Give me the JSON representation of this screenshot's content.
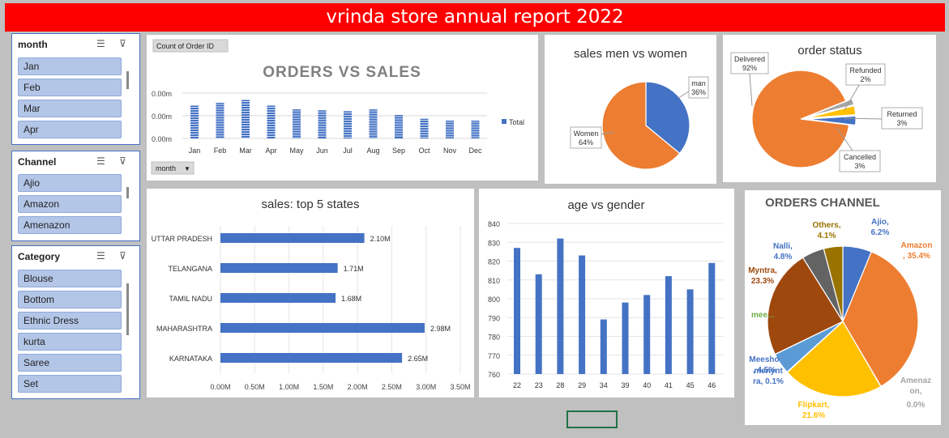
{
  "title": "vrinda store annual report 2022",
  "slicers": {
    "month": {
      "label": "month",
      "items": [
        "Jan",
        "Feb",
        "Mar",
        "Apr"
      ]
    },
    "channel": {
      "label": "Channel",
      "items": [
        "Ajio",
        "Amazon",
        "Amenazon"
      ]
    },
    "category": {
      "label": "Category",
      "items": [
        "Blouse",
        "Bottom",
        "Ethnic Dress",
        "kurta",
        "Saree",
        "Set"
      ]
    }
  },
  "colors": {
    "blue": "#4472c4",
    "orange": "#ed7d31",
    "gray": "#a5a5a5",
    "yellow": "#ffc000",
    "banner": "#ff0000",
    "green": "#70ad47",
    "brown": "#9e480e",
    "darkgray": "#636363",
    "olive": "#997300"
  },
  "chart_data": [
    {
      "id": "orders_vs_sales",
      "type": "bar",
      "title": "ORDERS VS SALES",
      "field_button": "Count of Order ID",
      "axis_button": "month",
      "categories": [
        "Jan",
        "Feb",
        "Mar",
        "Apr",
        "May",
        "Jun",
        "Jul",
        "Aug",
        "Sep",
        "Oct",
        "Nov",
        "Dec"
      ],
      "series": [
        {
          "name": "Total",
          "values": [
            0.0035,
            0.0038,
            0.0041,
            0.0035,
            0.0031,
            0.003,
            0.0029,
            0.0031,
            0.0025,
            0.0021,
            0.0019,
            0.0019
          ]
        }
      ],
      "ytick_labels": [
        "0.00m",
        "0.00m",
        "0.00m"
      ],
      "legend": "right"
    },
    {
      "id": "sales_men_vs_women",
      "type": "pie",
      "title": "sales men vs women",
      "slices": [
        {
          "label": "man",
          "pct_label": "36%",
          "value": 36,
          "color": "#4472c4"
        },
        {
          "label": "Women",
          "pct_label": "64%",
          "value": 64,
          "color": "#ed7d31"
        }
      ]
    },
    {
      "id": "order_status",
      "type": "pie",
      "title": "order status",
      "slices": [
        {
          "label": "Delivered",
          "pct_label": "92%",
          "value": 92,
          "color": "#ed7d31"
        },
        {
          "label": "Refunded",
          "pct_label": "2%",
          "value": 2,
          "color": "#a5a5a5"
        },
        {
          "label": "Returned",
          "pct_label": "3%",
          "value": 3,
          "color": "#ffc000"
        },
        {
          "label": "Cancelled",
          "pct_label": "3%",
          "value": 3,
          "color": "#4472c4"
        }
      ]
    },
    {
      "id": "top5_states",
      "type": "bar",
      "orientation": "horizontal",
      "title": "sales: top 5 states",
      "categories": [
        "UTTAR PRADESH",
        "TELANGANA",
        "TAMIL NADU",
        "MAHARASHTRA",
        "KARNATAKA"
      ],
      "values": [
        2.1,
        1.71,
        1.68,
        2.98,
        2.65
      ],
      "value_labels": [
        "2.10M",
        "1.71M",
        "1.68M",
        "2.98M",
        "2.65M"
      ],
      "xlim": [
        0,
        3.5
      ],
      "xtick_labels": [
        "0.00M",
        "0.50M",
        "1.00M",
        "1.50M",
        "2.00M",
        "2.50M",
        "3.00M",
        "3.50M"
      ]
    },
    {
      "id": "age_vs_gender",
      "type": "bar",
      "title": "age vs gender",
      "categories": [
        "22",
        "23",
        "28",
        "29",
        "34",
        "39",
        "40",
        "41",
        "45",
        "46"
      ],
      "values": [
        827,
        813,
        832,
        823,
        789,
        798,
        802,
        812,
        805,
        819
      ],
      "ylim": [
        760,
        840
      ],
      "yticks": [
        760,
        770,
        780,
        790,
        800,
        810,
        820,
        830,
        840
      ]
    },
    {
      "id": "orders_channel",
      "type": "pie",
      "title": "ORDERS CHANNEL",
      "slices": [
        {
          "label": "Ajio,",
          "pct_label": "6.2%",
          "value": 6.2,
          "color": "#4472c4"
        },
        {
          "label": "Amazon",
          "pct_label": ", 35.4%",
          "value": 35.4,
          "color": "#ed7d31"
        },
        {
          "label": "Amenaz on,",
          "pct_label": "0.0%",
          "value": 0.05,
          "color": "#a5a5a5"
        },
        {
          "label": "Flipkart,",
          "pct_label": "21.6%",
          "value": 21.6,
          "color": "#ffc000"
        },
        {
          "label": "menynt ra,",
          "pct_label": "0.1%",
          "value": 0.1,
          "color": "#5b9bd5"
        },
        {
          "label": "Meesho",
          "pct_label": ", 4.5%",
          "value": 4.5,
          "color": "#5b9bd5"
        },
        {
          "label": "mee...",
          "pct_label": "",
          "value": 0.05,
          "color": "#70ad47"
        },
        {
          "label": "Myntra,",
          "pct_label": "23.3%",
          "value": 23.3,
          "color": "#9e480e"
        },
        {
          "label": "Nalli,",
          "pct_label": "4.8%",
          "value": 4.8,
          "color": "#636363"
        },
        {
          "label": "Others,",
          "pct_label": "4.1%",
          "value": 4.1,
          "color": "#997300"
        }
      ]
    }
  ]
}
